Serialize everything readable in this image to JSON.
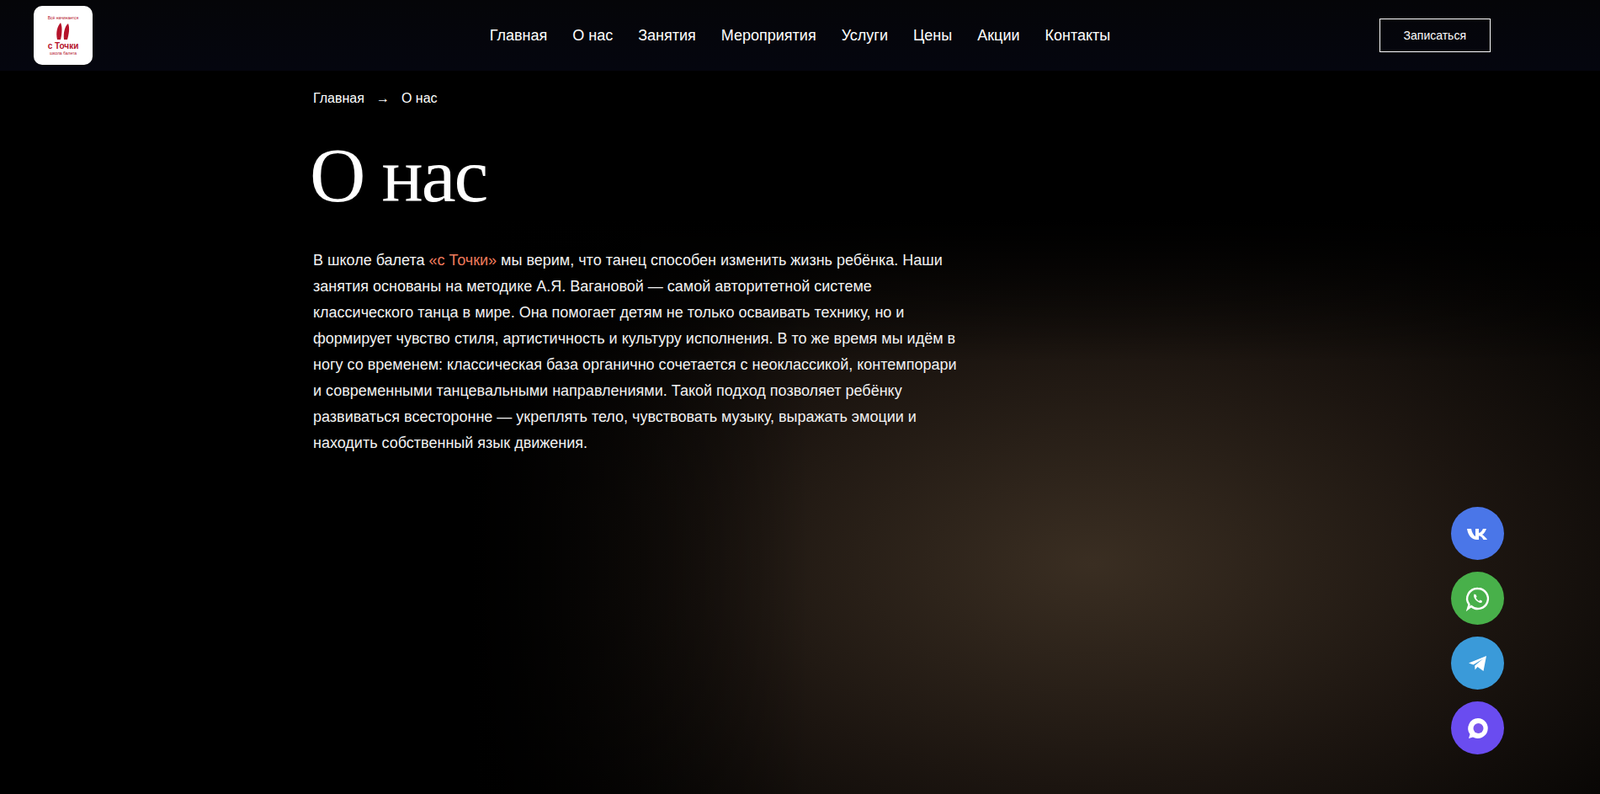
{
  "logo": {
    "top": "Всё начинается",
    "name": "с Точки",
    "bottom": "школа балета"
  },
  "nav": {
    "items": [
      "Главная",
      "О нас",
      "Занятия",
      "Мероприятия",
      "Услуги",
      "Цены",
      "Акции",
      "Контакты"
    ]
  },
  "cta": "Записаться",
  "breadcrumb": {
    "items": [
      "Главная",
      "О нас"
    ],
    "separator": "→"
  },
  "title": "О нас",
  "paragraph": {
    "before": "В школе балета ",
    "highlight": "«с Точки»",
    "after": " мы верим, что танец способен изменить жизнь ребёнка. Наши занятия основаны на методике А.Я. Вагановой — самой авторитетной системе классического танца в мире. Она помогает детям не только осваивать технику, но и формирует чувство стиля, артистичность и культуру исполнения. В то же время мы идём в ногу со временем: классическая база органично сочетается с неоклассикой, контемпорари и современными танцевальными направлениями. Такой подход позволяет ребёнку развиваться всесторонне — укреплять тело, чувствовать музыку, выражать эмоции и находить собственный язык движения."
  },
  "social": [
    {
      "kind": "vk",
      "color": "#4a76e8"
    },
    {
      "kind": "whatsapp",
      "color": "#48b04a"
    },
    {
      "kind": "telegram",
      "color": "#3a9ad9"
    },
    {
      "kind": "max",
      "color": "#6a4cf0"
    }
  ]
}
